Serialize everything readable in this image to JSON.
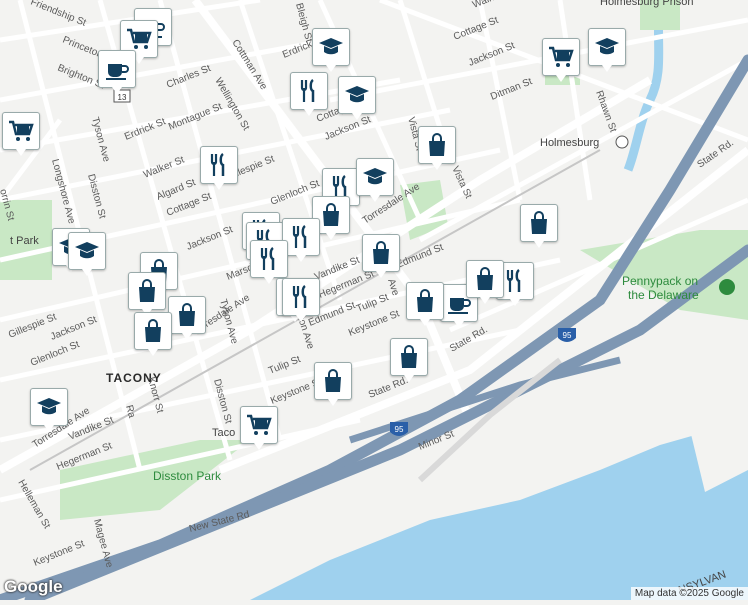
{
  "map": {
    "credit": "Map data ©2025 Google",
    "logo": "Google",
    "neighborhood": "TACONY",
    "places": {
      "holmesburg": "Holmesburg",
      "prison": "Holmesburg Prison",
      "pennypack_1": "Pennypack on",
      "pennypack_2": "the Delaware",
      "disston_park": "Disston Park",
      "taco": "Taco",
      "park_partial": "t Park",
      "penn_partial": "NSYLVAN"
    },
    "highway_shield": "95",
    "route_shield": "13",
    "streets": {
      "cottman": "Cottman Ave",
      "torresdale_e": "Torresdale Ave",
      "torresdale_w": "Torresdale Ave",
      "torresdale_sw": "Torresdale Ave",
      "state_e": "State Rd.",
      "state_c": "State Rd.",
      "new_state": "New State Rd",
      "minor": "Minor St",
      "rhawn": "Rhawn St",
      "tyson": "Tyson Ave",
      "tyson_s": "Tyson Ave",
      "disston": "Disston St",
      "disston_s": "Disston St",
      "longshore": "Longshore Ave",
      "brighton": "Brighton St",
      "princeton": "Princeton Ave",
      "friendship": "Friendship St",
      "charles": "Charles St",
      "wellington": "Wellington St",
      "montague": "Montague St",
      "erdrick_w": "Erdrick St",
      "erdrick_n": "Erdrick St",
      "walker": "Walker St",
      "algard": "Algard St",
      "cottage_w": "Cottage St",
      "cottage_n": "Cottage St",
      "cottage_ne": "Cottage St",
      "gillespie": "Gillespie St",
      "gillespie_w": "Gillespie St",
      "jackson_w": "Jackson St",
      "jackson_c": "Jackson St",
      "jackson_n": "Jackson St",
      "jackson_sw": "Jackson St",
      "glenloch": "Glenloch St",
      "glenloch_w": "Glenloch St",
      "marsden": "Marsden St",
      "vandike": "Vandike St",
      "vandike_w": "Vandike St",
      "hegerman": "Hegerman St",
      "hegerman_w": "Hegerman St",
      "helleman": "Helleman St",
      "edmund": "Edmund St",
      "edmund_w": "Edmund St",
      "tulip_w": "Tulip St",
      "tulip_c": "Tulip St",
      "keystone_c": "Keystone St",
      "keystone_w": "Keystone St",
      "keystone_sw": "Keystone St",
      "knorr": "Knorr St",
      "magee": "Magee Ave",
      "ditman": "Ditman St",
      "vista_n": "Vista St",
      "vista": "Vista St",
      "bleigh": "Bleigh St",
      "walker_n": "Walker St",
      "mon_partial": "ton Ave",
      "ave_partial": "Ave",
      "sidebox": "Ave",
      "orrin": "orrin St",
      "raw": "Ra"
    },
    "markers": [
      {
        "icon": "coffee-icon"
      },
      {
        "icon": "shopping-cart-icon"
      },
      {
        "icon": "coffee-icon"
      },
      {
        "icon": "school-icon"
      },
      {
        "icon": "restaurant-icon"
      },
      {
        "icon": "school-icon"
      },
      {
        "icon": "shopping-cart-icon"
      },
      {
        "icon": "school-icon"
      },
      {
        "icon": "shopping-cart-icon"
      },
      {
        "icon": "shopping-bag-icon"
      },
      {
        "icon": "restaurant-icon"
      },
      {
        "icon": "restaurant-icon"
      },
      {
        "icon": "school-icon"
      },
      {
        "icon": "shopping-bag-icon"
      },
      {
        "icon": "restaurant-icon"
      },
      {
        "icon": "restaurant-icon"
      },
      {
        "icon": "restaurant-icon"
      },
      {
        "icon": "restaurant-icon"
      },
      {
        "icon": "shopping-bag-icon"
      },
      {
        "icon": "shopping-bag-icon"
      },
      {
        "icon": "school-icon"
      },
      {
        "icon": "school-icon"
      },
      {
        "icon": "shopping-bag-icon"
      },
      {
        "icon": "shopping-bag-icon"
      },
      {
        "icon": "shopping-bag-icon"
      },
      {
        "icon": "restaurant-icon"
      },
      {
        "icon": "restaurant-icon"
      },
      {
        "icon": "shopping-bag-icon"
      },
      {
        "icon": "coffee-icon"
      },
      {
        "icon": "shopping-bag-icon"
      },
      {
        "icon": "restaurant-icon"
      },
      {
        "icon": "shopping-bag-icon"
      },
      {
        "icon": "shopping-bag-icon"
      },
      {
        "icon": "shopping-bag-icon"
      },
      {
        "icon": "shopping-cart-icon"
      },
      {
        "icon": "school-icon"
      }
    ],
    "colors": {
      "water": "#9fd1ee",
      "park": "#c9e8c5",
      "highway": "#7e97b3",
      "marker": "#123f5e"
    }
  }
}
